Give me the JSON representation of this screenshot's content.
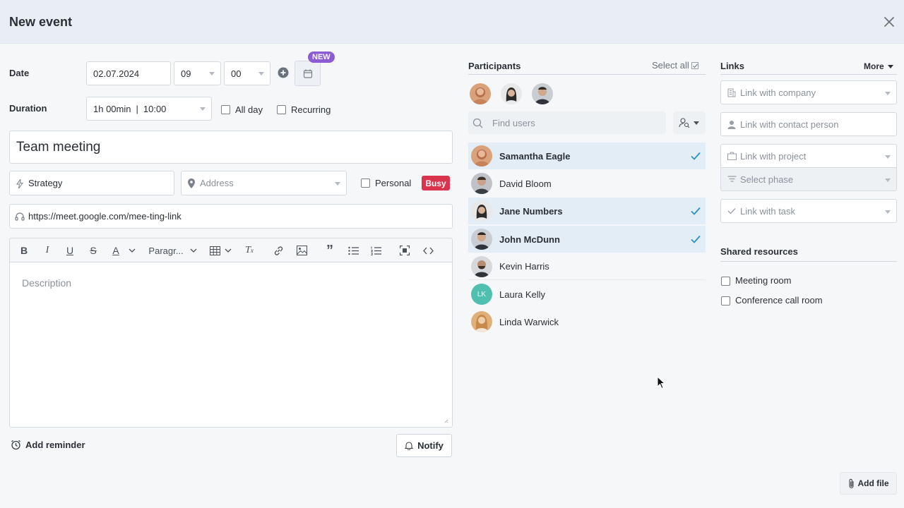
{
  "header": {
    "title": "New event"
  },
  "date": {
    "label": "Date",
    "value": "02.07.2024",
    "hour": "09",
    "minute": "00",
    "badge": "NEW"
  },
  "duration": {
    "label": "Duration",
    "value": "1h 00min",
    "end_time": "10:00",
    "all_day": "All day",
    "recurring": "Recurring"
  },
  "title_input": "Team meeting",
  "type": "Strategy",
  "address_placeholder": "Address",
  "personal_label": "Personal",
  "busy_label": "Busy",
  "meeting_link": "https://meet.google.com/mee-ting-link",
  "editor": {
    "paragraph": "Paragr...",
    "placeholder": "Description"
  },
  "add_reminder": "Add reminder",
  "notify": "Notify",
  "participants": {
    "title": "Participants",
    "select_all": "Select all",
    "find_placeholder": "Find users",
    "list": [
      {
        "name": "Samantha Eagle",
        "selected": true
      },
      {
        "name": "David Bloom",
        "selected": false
      },
      {
        "name": "Jane Numbers",
        "selected": true
      },
      {
        "name": "John McDunn",
        "selected": true
      },
      {
        "name": "Kevin Harris",
        "selected": false
      },
      {
        "name": "Laura Kelly",
        "selected": false,
        "initials": "LK"
      },
      {
        "name": "Linda Warwick",
        "selected": false
      }
    ]
  },
  "links": {
    "title": "Links",
    "more": "More",
    "company": "Link with company",
    "contact": "Link with contact person",
    "project": "Link with project",
    "phase": "Select phase",
    "task": "Link with task"
  },
  "shared": {
    "title": "Shared resources",
    "items": [
      "Meeting room",
      "Conference call room"
    ]
  },
  "add_file": "Add file",
  "colors": {
    "accent": "#2a8fc7",
    "busy": "#d9334d",
    "badge": "#8b5cd6",
    "selected_row": "#e2edf5"
  }
}
